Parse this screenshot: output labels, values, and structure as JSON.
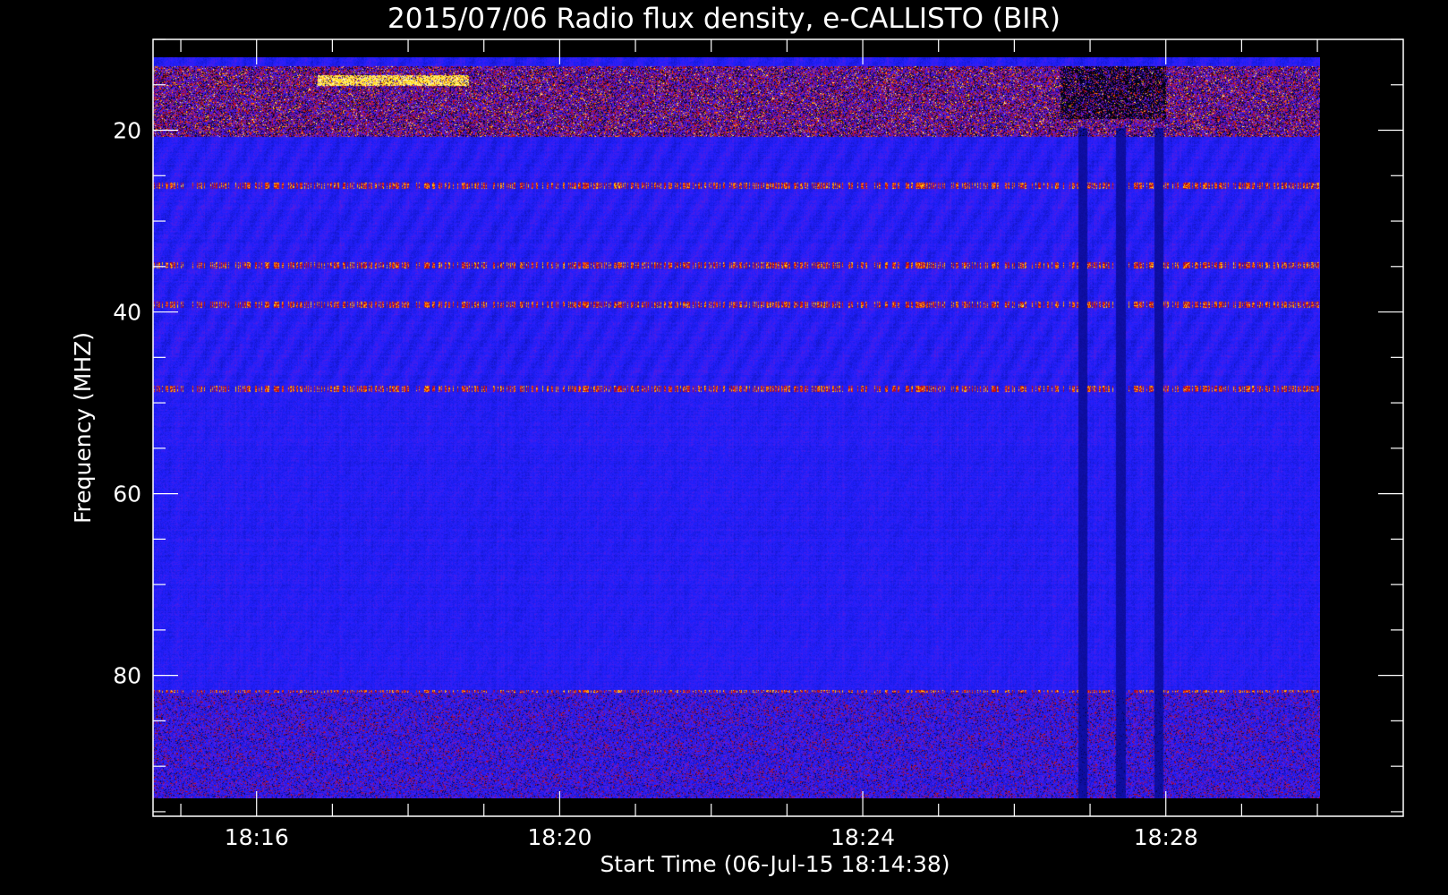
{
  "chart_data": {
    "type": "heatmap",
    "title": "2015/07/06  Radio flux density, e-CALLISTO (BIR)",
    "xlabel": "Start Time (06-Jul-15 18:14:38)",
    "ylabel": "Frequency (MHZ)",
    "x_tick_labels": [
      "18:16",
      "18:20",
      "18:24",
      "18:28"
    ],
    "x_tick_minutes": [
      16,
      20,
      24,
      28
    ],
    "x_range_minutes": [
      14.6333,
      31.1333
    ],
    "x_data_range_minutes": [
      14.6333,
      30.0333
    ],
    "y_tick_labels": [
      "20",
      "40",
      "60",
      "80"
    ],
    "y_tick_values": [
      20,
      40,
      60,
      80
    ],
    "y_range": [
      10,
      95.5
    ],
    "y_data_range": [
      12,
      96
    ],
    "y_inverted": true,
    "colormap": [
      "#000000",
      "#0a0a8c",
      "#2020ff",
      "#6a1ad6",
      "#b40000",
      "#ff4400",
      "#ffd700",
      "#ffffc8"
    ],
    "background_color": "#1a1aff",
    "features": {
      "strong_rfi_band_mhz": [
        13,
        21
      ],
      "horizontal_interference_lines_mhz": [
        26.5,
        35.5,
        40,
        49.5,
        84,
        87
      ],
      "vertical_dark_streaks_minutes": [
        26.9,
        27.4,
        27.9
      ],
      "low_band_noise_mhz": [
        84,
        96
      ]
    }
  }
}
